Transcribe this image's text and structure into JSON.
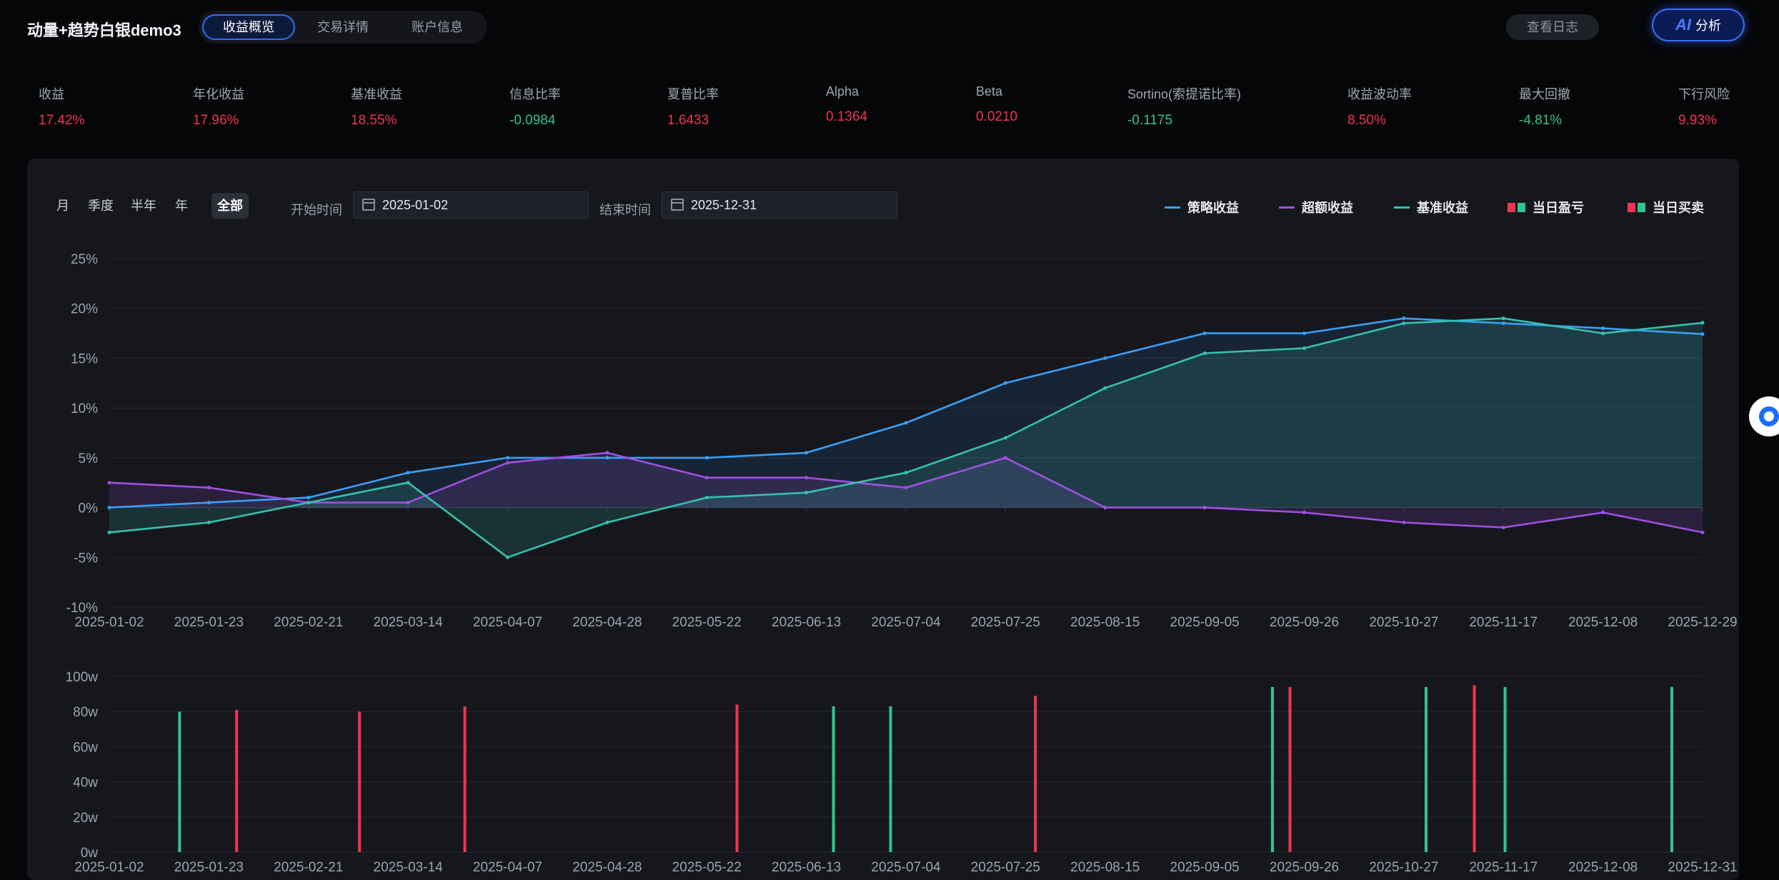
{
  "header": {
    "title": "动量+趋势白银demo3",
    "tabs": [
      {
        "label": "收益概览",
        "active": true
      },
      {
        "label": "交易详情",
        "active": false
      },
      {
        "label": "账户信息",
        "active": false
      }
    ],
    "log_button": "查看日志",
    "ai_button": {
      "mark": "AI",
      "label": "分析"
    }
  },
  "metrics": [
    {
      "label": "收益",
      "value": "17.42%",
      "tone": "red"
    },
    {
      "label": "年化收益",
      "value": "17.96%",
      "tone": "red"
    },
    {
      "label": "基准收益",
      "value": "18.55%",
      "tone": "red"
    },
    {
      "label": "信息比率",
      "value": "-0.0984",
      "tone": "green"
    },
    {
      "label": "夏普比率",
      "value": "1.6433",
      "tone": "red"
    },
    {
      "label": "Alpha",
      "value": "0.1364",
      "tone": "red"
    },
    {
      "label": "Beta",
      "value": "0.0210",
      "tone": "red"
    },
    {
      "label": "Sortino(索提诺比率)",
      "value": "-0.1175",
      "tone": "green"
    },
    {
      "label": "收益波动率",
      "value": "8.50%",
      "tone": "red"
    },
    {
      "label": "最大回撤",
      "value": "-4.81%",
      "tone": "green"
    },
    {
      "label": "下行风险",
      "value": "9.93%",
      "tone": "red"
    }
  ],
  "filters": {
    "periods": [
      "月",
      "季度",
      "半年",
      "年",
      "全部"
    ],
    "active_period": "全部",
    "start_label": "开始时间",
    "start_value": "2025-01-02",
    "end_label": "结束时间",
    "end_value": "2025-12-31"
  },
  "colors": {
    "strategy": "#3a9ff5",
    "excess": "#a04fe3",
    "benchmark": "#35c1b0",
    "up": "#f2344f",
    "down": "#2ec68b"
  },
  "chart_data": [
    {
      "type": "line",
      "ylim": [
        -10,
        25
      ],
      "y_ticks": [
        "-10%",
        "-5%",
        "0%",
        "5%",
        "10%",
        "15%",
        "20%",
        "25%"
      ],
      "x_ticks": [
        "2025-01-02",
        "2025-01-23",
        "2025-02-21",
        "2025-03-14",
        "2025-04-07",
        "2025-04-28",
        "2025-05-22",
        "2025-06-13",
        "2025-07-04",
        "2025-07-25",
        "2025-08-15",
        "2025-09-05",
        "2025-09-26",
        "2025-10-27",
        "2025-11-17",
        "2025-12-08",
        "2025-12-29"
      ],
      "x": [
        "2025-01-02",
        "2025-01-23",
        "2025-02-21",
        "2025-03-14",
        "2025-04-07",
        "2025-04-28",
        "2025-05-22",
        "2025-06-13",
        "2025-07-04",
        "2025-07-25",
        "2025-08-15",
        "2025-09-05",
        "2025-09-26",
        "2025-10-27",
        "2025-11-17",
        "2025-12-08",
        "2025-12-29"
      ],
      "series": [
        {
          "name": "策略收益",
          "values": [
            0,
            0.5,
            1.0,
            3.5,
            5.0,
            5.0,
            5.0,
            5.5,
            8.5,
            12.5,
            15.0,
            17.5,
            17.5,
            19.0,
            18.5,
            18.0,
            17.42
          ]
        },
        {
          "name": "超额收益",
          "values": [
            2.5,
            2.0,
            0.5,
            0.5,
            4.5,
            5.5,
            3.0,
            3.0,
            2.0,
            5.0,
            0.0,
            0.0,
            -0.5,
            -1.5,
            -2.0,
            -0.5,
            -2.5
          ]
        },
        {
          "name": "基准收益",
          "values": [
            -2.5,
            -1.5,
            0.5,
            2.5,
            -5.0,
            -1.5,
            1.0,
            1.5,
            3.5,
            7.0,
            12.0,
            15.5,
            16.0,
            18.5,
            19.0,
            17.5,
            18.55
          ]
        }
      ],
      "legend": [
        {
          "label": "策略收益",
          "kind": "line",
          "color": "#3a9ff5"
        },
        {
          "label": "超额收益",
          "kind": "line",
          "color": "#a04fe3"
        },
        {
          "label": "基准收益",
          "kind": "line",
          "color": "#35c1b0"
        },
        {
          "label": "当日盈亏",
          "kind": "squares"
        },
        {
          "label": "当日买卖",
          "kind": "squares"
        }
      ],
      "legend_position": "top-right",
      "grid": true
    },
    {
      "type": "bar",
      "ylim": [
        0,
        100
      ],
      "y_ticks": [
        "0w",
        "20w",
        "40w",
        "60w",
        "80w",
        "100w"
      ],
      "x_ticks": [
        "2025-01-02",
        "2025-01-23",
        "2025-02-21",
        "2025-03-14",
        "2025-04-07",
        "2025-04-28",
        "2025-05-22",
        "2025-06-13",
        "2025-07-04",
        "2025-07-25",
        "2025-08-15",
        "2025-09-05",
        "2025-09-26",
        "2025-10-27",
        "2025-11-17",
        "2025-12-08",
        "2025-12-31"
      ],
      "bars": [
        {
          "date": "2025-01-18",
          "value": 80,
          "side": "down"
        },
        {
          "date": "2025-01-31",
          "value": 81,
          "side": "up"
        },
        {
          "date": "2025-02-28",
          "value": 80,
          "side": "up"
        },
        {
          "date": "2025-03-24",
          "value": 83,
          "side": "up"
        },
        {
          "date": "2025-05-25",
          "value": 84,
          "side": "up"
        },
        {
          "date": "2025-06-16",
          "value": 83,
          "side": "down"
        },
        {
          "date": "2025-06-29",
          "value": 83,
          "side": "down"
        },
        {
          "date": "2025-08-01",
          "value": 89,
          "side": "up"
        },
        {
          "date": "2025-09-24",
          "value": 94,
          "side": "down"
        },
        {
          "date": "2025-09-28",
          "value": 94,
          "side": "up"
        },
        {
          "date": "2025-10-29",
          "value": 94,
          "side": "down"
        },
        {
          "date": "2025-11-09",
          "value": 95,
          "side": "up"
        },
        {
          "date": "2025-11-16",
          "value": 94,
          "side": "down"
        },
        {
          "date": "2025-12-24",
          "value": 94,
          "side": "down"
        }
      ],
      "grid": true
    }
  ]
}
